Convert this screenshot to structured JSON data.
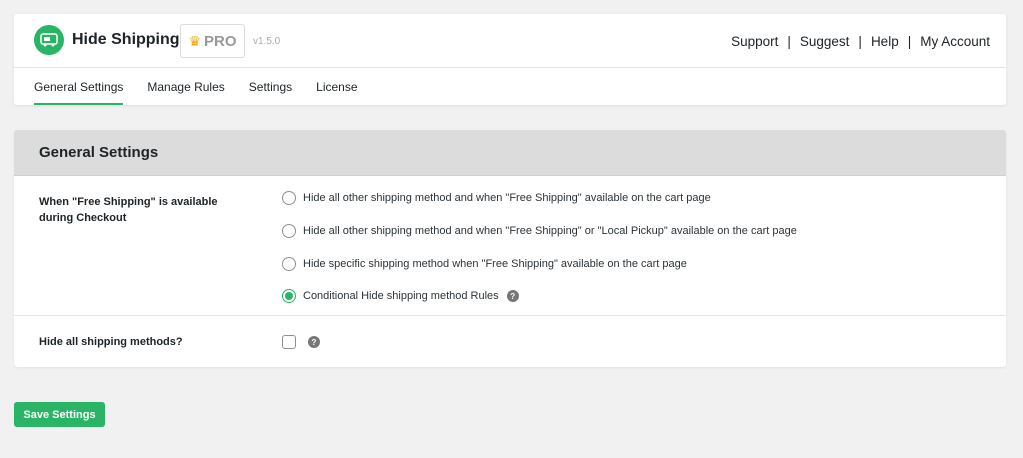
{
  "header": {
    "title": "Hide Shipping",
    "pro_label": "PRO",
    "version": "v1.5.0",
    "links": [
      "Support",
      "Suggest",
      "Help",
      "My Account"
    ],
    "separator": "|"
  },
  "tabs": [
    {
      "label": "General Settings",
      "active": true
    },
    {
      "label": "Manage Rules",
      "active": false
    },
    {
      "label": "Settings",
      "active": false
    },
    {
      "label": "License",
      "active": false
    }
  ],
  "settings": {
    "heading": "General Settings",
    "free_shipping": {
      "label": "When \"Free Shipping\" is available during Checkout",
      "options": [
        {
          "label": "Hide all other shipping method and when \"Free Shipping\" available on the cart page",
          "checked": false
        },
        {
          "label": "Hide all other shipping method and when \"Free Shipping\" or \"Local Pickup\" available on the cart page",
          "checked": false
        },
        {
          "label": "Hide specific shipping method when \"Free Shipping\" available on the cart page",
          "checked": false
        },
        {
          "label": "Conditional Hide shipping method Rules",
          "checked": true
        }
      ]
    },
    "hide_all": {
      "label": "Hide all shipping methods?",
      "checked": false
    },
    "help_glyph": "?"
  },
  "save_button": "Save Settings",
  "colors": {
    "accent": "#2ab466",
    "crown": "#f2a81c"
  },
  "icons": {
    "logo": "truck-icon",
    "crown": "crown-icon",
    "help": "help-icon"
  }
}
